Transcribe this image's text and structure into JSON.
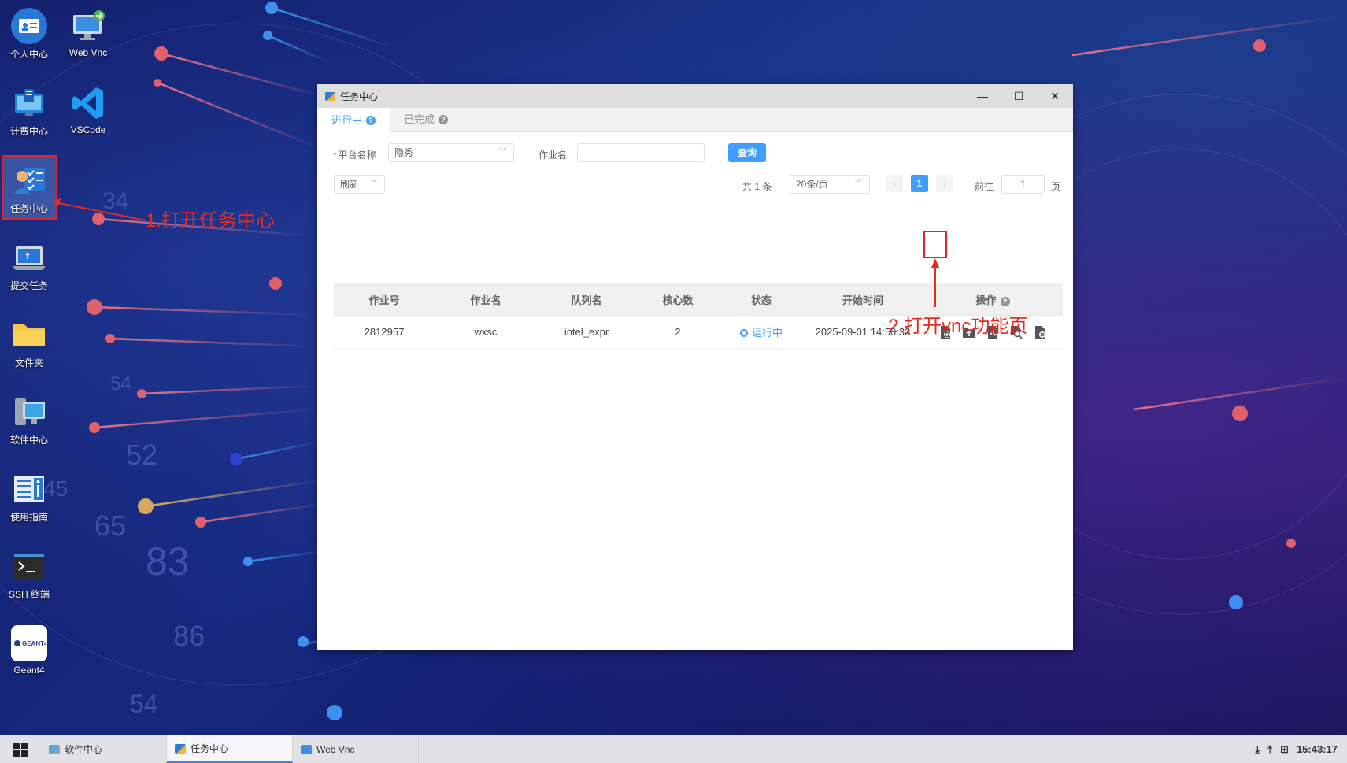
{
  "desktop": {
    "icons": [
      {
        "label": "个人中心",
        "icon": "id-card-icon",
        "color": "#2a78d6"
      },
      {
        "label": "Web Vnc",
        "icon": "monitor-remote-icon",
        "color": "#4aa3e0"
      },
      {
        "label": "计费中心",
        "icon": "billing-monitor-icon",
        "color": "#1e88d8"
      },
      {
        "label": "VSCode",
        "icon": "vscode-icon",
        "color": "#1f9cf0"
      },
      {
        "label": "任务中心",
        "icon": "task-center-icon",
        "color": "#2a78d6"
      },
      {
        "label": "提交任务",
        "icon": "laptop-submit-icon",
        "color": "#2a78d6"
      },
      {
        "label": "文件夹",
        "icon": "folder-icon",
        "color": "#f6c343"
      },
      {
        "label": "软件中心",
        "icon": "software-center-icon",
        "color": "#3aa6e6"
      },
      {
        "label": "使用指南",
        "icon": "guide-icon",
        "color": "#2a78d6"
      },
      {
        "label": "SSH 终端",
        "icon": "terminal-icon",
        "color": "#2b2b2b"
      },
      {
        "label": "Geant4",
        "icon": "geant4-logo-icon",
        "color": "#ffffff",
        "logo_text": "GEANT4"
      }
    ]
  },
  "annotations": {
    "step1": "1.打开任务中心",
    "step2": "2.打开vnc功能页"
  },
  "window": {
    "title": "任务中心",
    "tabs": [
      {
        "label": "进行中",
        "active": true
      },
      {
        "label": "已完成",
        "active": false
      }
    ],
    "filter": {
      "platform_label": "平台名称",
      "platform_value": "隐秀",
      "job_name_label": "作业名",
      "job_name_value": "",
      "query_button": "查询"
    },
    "toolbar": {
      "refresh_label": "刷新"
    },
    "pagination": {
      "total": "共 1 条",
      "page_size": "20条/页",
      "current_page": "1",
      "goto_label": "前往",
      "goto_value": "1",
      "page_unit": "页"
    },
    "table": {
      "headers": [
        "作业号",
        "作业名",
        "队列名",
        "核心数",
        "状态",
        "开始时间",
        "操作"
      ],
      "rows": [
        {
          "job_id": "2812957",
          "job_name": "wxsc",
          "queue": "intel_expr",
          "cores": "2",
          "status": "运行中",
          "start_time": "2025-09-01 14:50:33"
        }
      ],
      "operations": [
        "vnc-settings-icon",
        "upload-icon",
        "monitor-file-icon",
        "search-file-icon",
        "delete-file-icon"
      ]
    }
  },
  "taskbar": {
    "items": [
      {
        "label": "软件中心",
        "active": false
      },
      {
        "label": "任务中心",
        "active": true
      },
      {
        "label": "Web Vnc",
        "active": false
      }
    ],
    "clock": "15:43:17"
  },
  "colors": {
    "accent": "#409eff",
    "annotation": "#e52a20"
  }
}
